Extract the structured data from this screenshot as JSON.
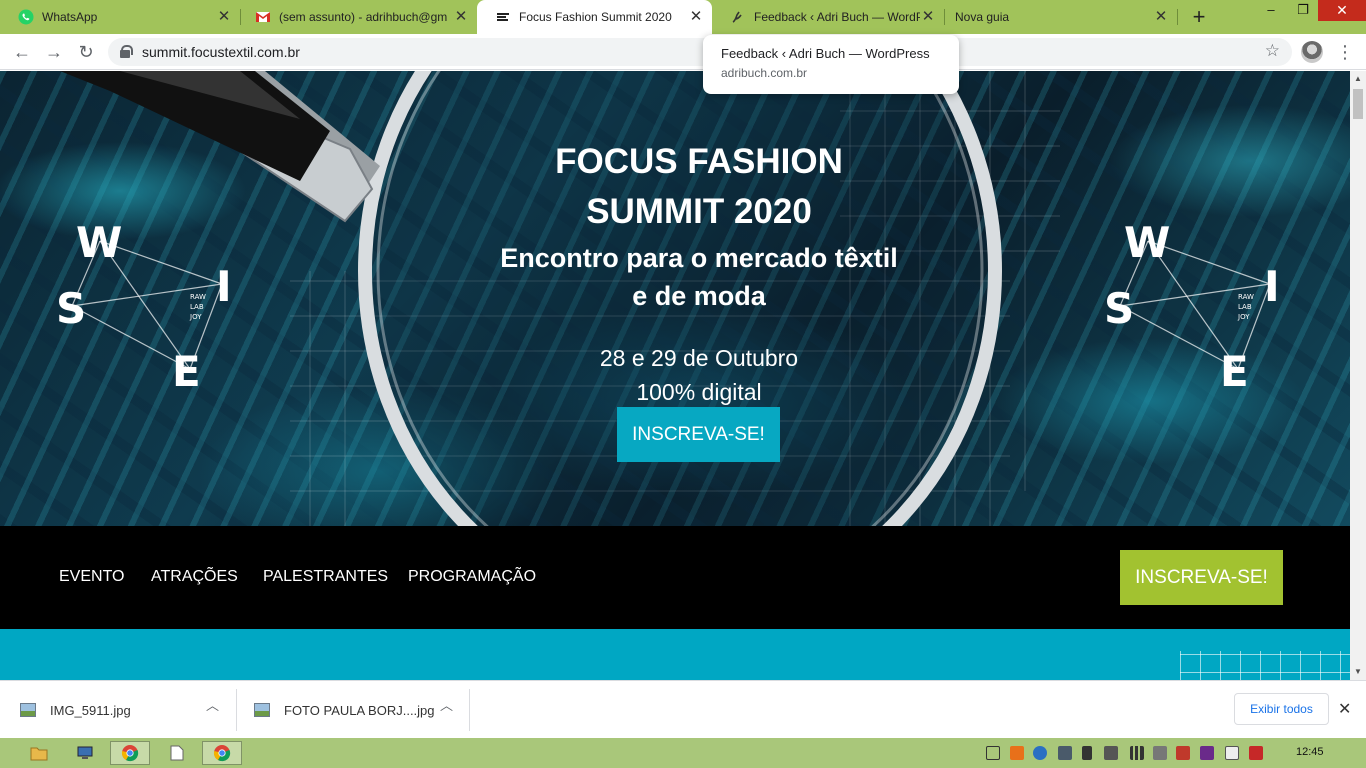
{
  "tabs": [
    {
      "title": "WhatsApp",
      "icon": "whatsapp-icon",
      "active": false
    },
    {
      "title": "(sem assunto) - adrihbuch@gm",
      "icon": "gmail-icon",
      "active": false
    },
    {
      "title": "Focus Fashion Summit 2020",
      "icon": "focus-summit-icon",
      "active": true
    },
    {
      "title": "Feedback ‹ Adri Buch — WordPr",
      "icon": "wordpress-icon",
      "active": false
    },
    {
      "title": "Nova guia",
      "icon": "",
      "active": false
    }
  ],
  "toolbar": {
    "url": "summit.focustextil.com.br"
  },
  "tooltip": {
    "title": "Feedback ‹ Adri Buch — WordPress",
    "domain": "adribuch.com.br"
  },
  "hero": {
    "title_line1": "FOCUS FASHION",
    "title_line2": "SUMMIT 2020",
    "subtitle_line1": "Encontro para o mercado têxtil",
    "subtitle_line2": "e de moda",
    "dates": "28 e 29 de Outubro",
    "format": "100% digital",
    "cta": "INSCREVA-SE!",
    "compass_letters": [
      "W",
      "I",
      "S",
      "E"
    ],
    "compass_small": [
      "RAW",
      "LAB",
      "JOY"
    ]
  },
  "nav": {
    "items": [
      "EVENTO",
      "ATRAÇÕES",
      "PALESTRANTES",
      "PROGRAMAÇÃO"
    ],
    "cta": "INSCREVA-SE!"
  },
  "downloads": {
    "items": [
      {
        "name": "IMG_5911.jpg"
      },
      {
        "name": "FOTO PAULA BORJ....jpg"
      }
    ],
    "show_all": "Exibir todos"
  },
  "taskbar": {
    "clock": "12:45"
  },
  "colors": {
    "tab_strip": "#a1c35a",
    "hero_cta": "#07a8c2",
    "nav_cta": "#a2c230",
    "teal_band": "#00a7c3",
    "nav_bg": "#000000"
  }
}
